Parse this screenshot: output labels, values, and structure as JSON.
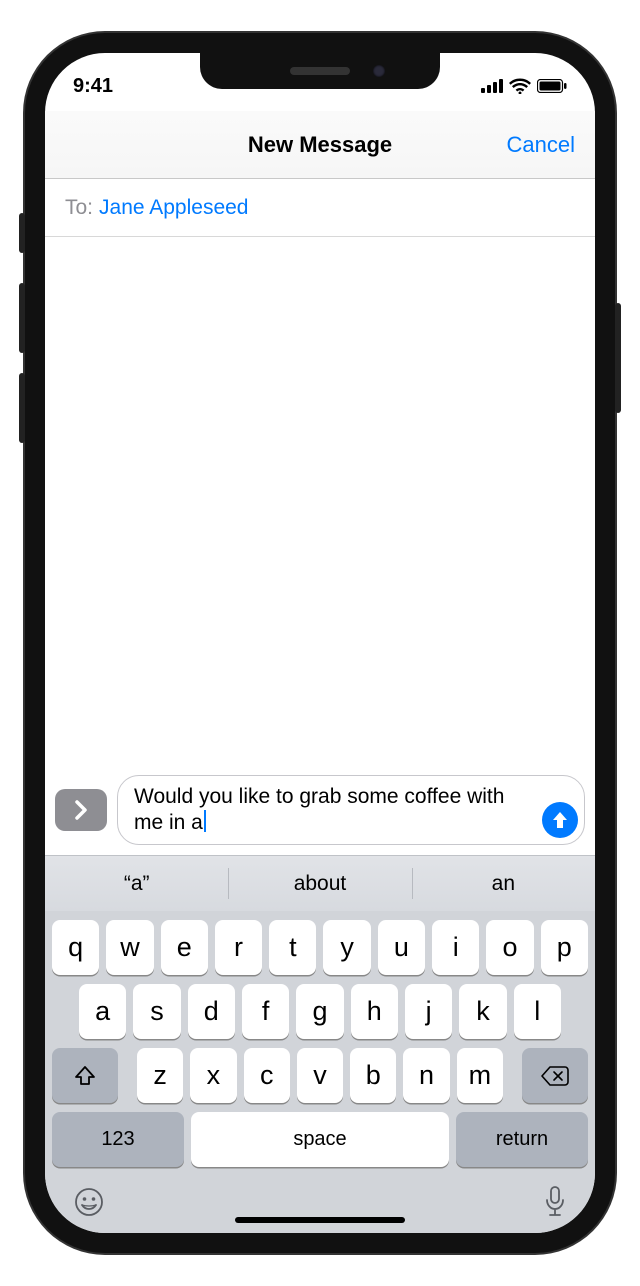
{
  "status": {
    "time": "9:41"
  },
  "nav": {
    "title": "New Message",
    "cancel": "Cancel"
  },
  "to": {
    "label": "To:",
    "recipient": "Jane Appleseed"
  },
  "compose": {
    "text": "Would you like to grab some coffee with me in a"
  },
  "predictive": [
    "“a”",
    "about",
    "an"
  ],
  "keyboard": {
    "row1": [
      "q",
      "w",
      "e",
      "r",
      "t",
      "y",
      "u",
      "i",
      "o",
      "p"
    ],
    "row2": [
      "a",
      "s",
      "d",
      "f",
      "g",
      "h",
      "j",
      "k",
      "l"
    ],
    "row3": [
      "z",
      "x",
      "c",
      "v",
      "b",
      "n",
      "m"
    ],
    "numbers": "123",
    "space": "space",
    "return": "return"
  }
}
